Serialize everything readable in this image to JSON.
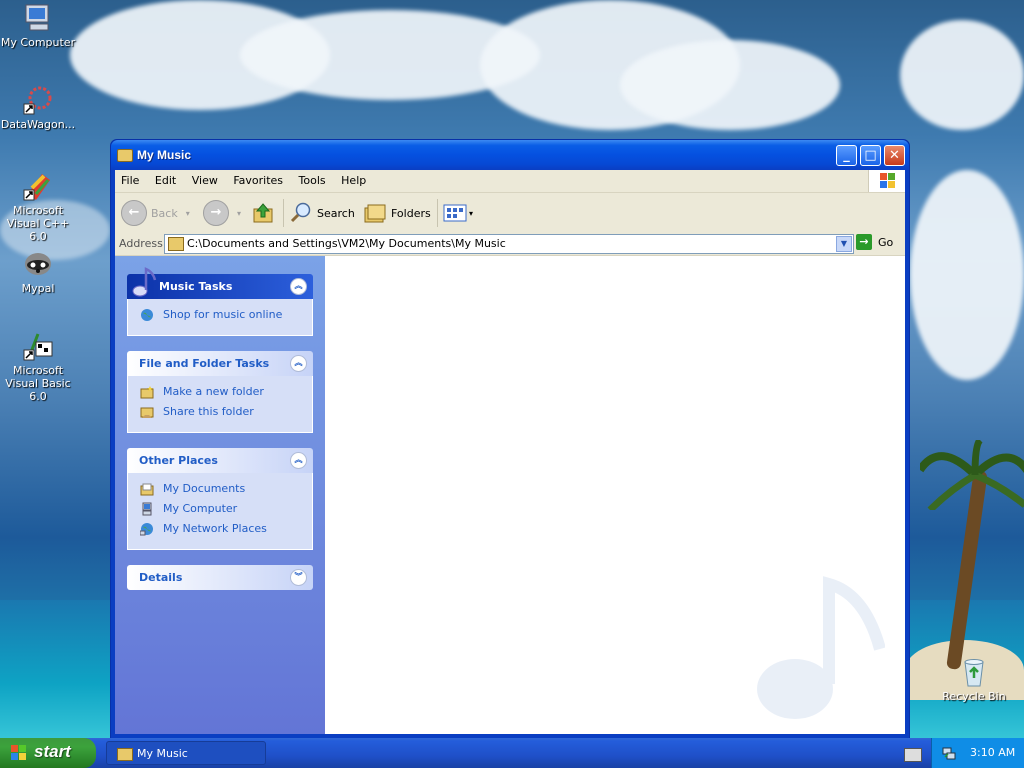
{
  "desktop": {
    "icons": [
      {
        "label": "My Computer"
      },
      {
        "label": "DataWagon..."
      },
      {
        "label": "Microsoft Visual C++ 6.0"
      },
      {
        "label": "Mypal"
      },
      {
        "label": "Microsoft Visual Basic 6.0"
      },
      {
        "label": "Recycle Bin"
      }
    ]
  },
  "window": {
    "title": "My Music",
    "menu": [
      "File",
      "Edit",
      "View",
      "Favorites",
      "Tools",
      "Help"
    ],
    "toolbar": {
      "back": "Back",
      "search": "Search",
      "folders": "Folders"
    },
    "address": {
      "label": "Address",
      "value": "C:\\Documents and Settings\\VM2\\My Documents\\My Music",
      "go": "Go"
    },
    "taskpane": {
      "music_tasks": {
        "title": "Music Tasks",
        "items": [
          "Shop for music online"
        ]
      },
      "file_folder_tasks": {
        "title": "File and Folder Tasks",
        "items": [
          "Make a new folder",
          "Share this folder"
        ]
      },
      "other_places": {
        "title": "Other Places",
        "items": [
          "My Documents",
          "My Computer",
          "My Network Places"
        ]
      },
      "details": {
        "title": "Details"
      }
    }
  },
  "taskbar": {
    "start": "start",
    "task_button": "My Music",
    "clock": "3:10 AM"
  },
  "colors": {
    "titlebar": "#0550e0",
    "taskpane_link": "#215dc6",
    "start_green": "#3ca23c",
    "taskbar_blue": "#245ddb",
    "tray_blue": "#0f8de6"
  }
}
